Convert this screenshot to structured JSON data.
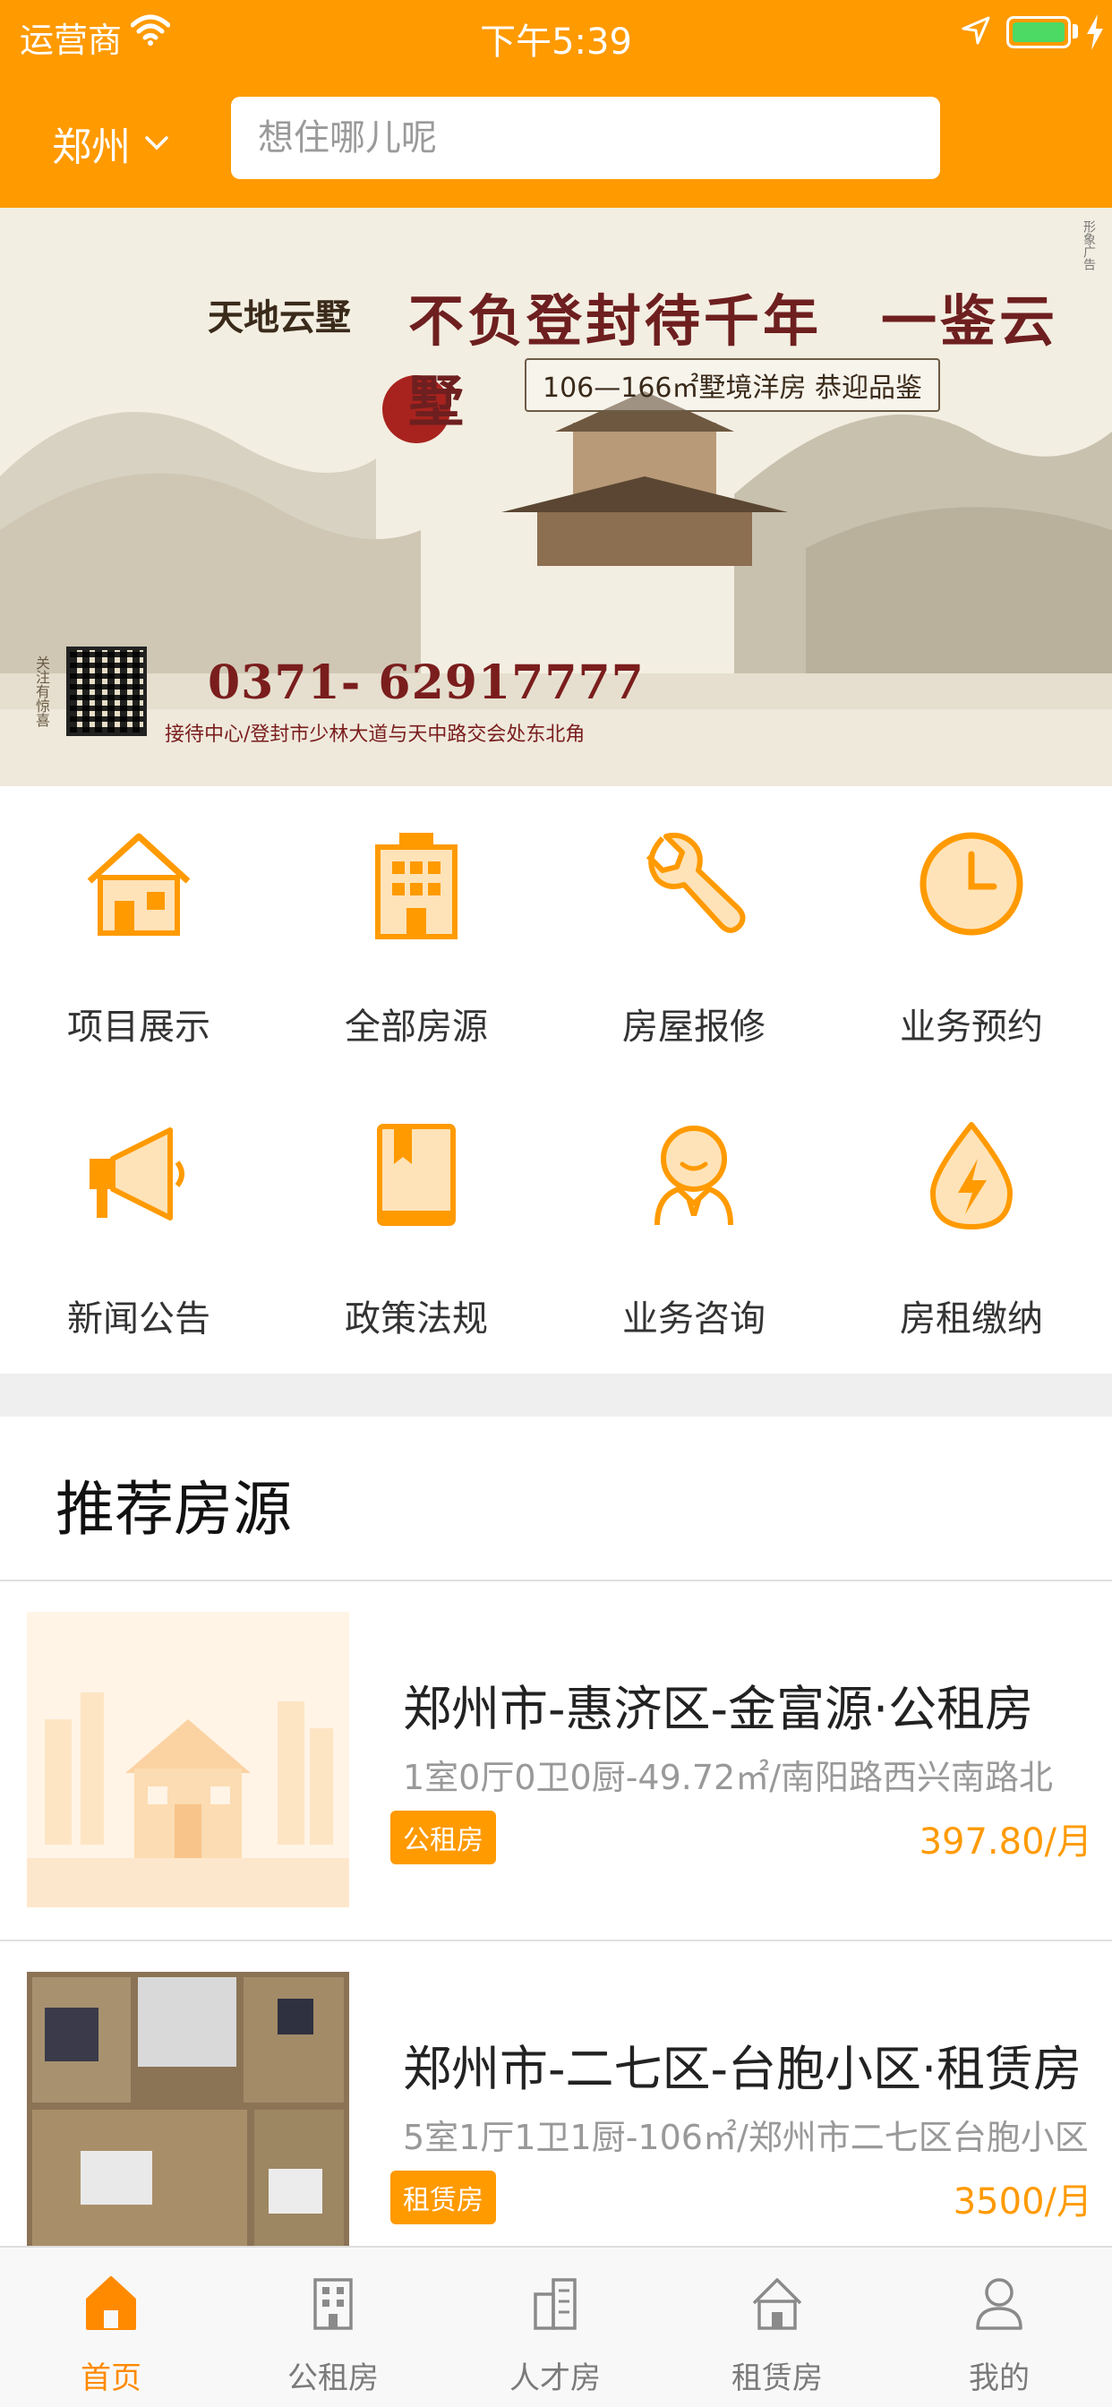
{
  "status_bar": {
    "carrier": "运营商",
    "time": "下午5:39"
  },
  "header": {
    "city": "郑州",
    "search_placeholder": "想住哪儿呢"
  },
  "banner": {
    "brand": "天地云墅",
    "headline": "不负登封待千年　一鉴云墅",
    "sub": "106—166㎡墅境洋房 恭迎品鉴",
    "phone": "0371- 62917777",
    "address": "接待中心/登封市少林大道与天中路交会处东北角",
    "follow": "关注有惊喜",
    "ad_label": "形象广告"
  },
  "grid": {
    "items": [
      {
        "label": "项目展示",
        "icon": "house-icon"
      },
      {
        "label": "全部房源",
        "icon": "building-icon"
      },
      {
        "label": "房屋报修",
        "icon": "wrench-icon"
      },
      {
        "label": "业务预约",
        "icon": "clock-icon"
      },
      {
        "label": "新闻公告",
        "icon": "megaphone-icon"
      },
      {
        "label": "政策法规",
        "icon": "book-icon"
      },
      {
        "label": "业务咨询",
        "icon": "consultant-icon"
      },
      {
        "label": "房租缴纳",
        "icon": "energy-drop-icon"
      }
    ]
  },
  "recommend": {
    "title": "推荐房源",
    "items": [
      {
        "title": "郑州市-惠济区-金富源·公租房",
        "desc": "1室0厅0卫0厨-49.72㎡/南阳路西兴南路北",
        "badge": "公租房",
        "price": "397.80/月"
      },
      {
        "title": "郑州市-二七区-台胞小区·租赁房",
        "desc": "5室1厅1卫1厨-106㎡/郑州市二七区台胞小区",
        "badge": "租赁房",
        "price": "3500/月"
      }
    ]
  },
  "tabbar": {
    "tabs": [
      {
        "label": "首页",
        "icon": "home-icon",
        "active": true
      },
      {
        "label": "公租房",
        "icon": "building-icon"
      },
      {
        "label": "人才房",
        "icon": "towers-icon"
      },
      {
        "label": "租赁房",
        "icon": "rental-house-icon"
      },
      {
        "label": "我的",
        "icon": "user-icon"
      }
    ]
  },
  "colors": {
    "accent": "#ff9a00",
    "battery": "#4cd964"
  }
}
